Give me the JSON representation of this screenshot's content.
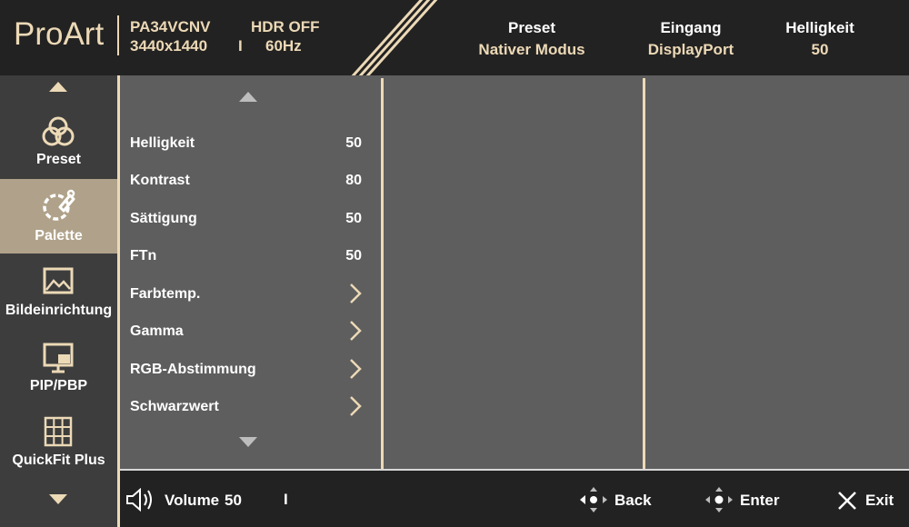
{
  "header": {
    "logo": "ProArt",
    "model": "PA34VCNV",
    "resolution": "3440x1440",
    "hdr": "HDR OFF",
    "separator": "I",
    "refresh": "60Hz",
    "preset_label": "Preset",
    "preset_value": "Nativer Modus",
    "input_label": "Eingang",
    "input_value": "DisplayPort",
    "brightness_label": "Helligkeit",
    "brightness_value": "50"
  },
  "sidebar": {
    "items": [
      {
        "label": "Preset",
        "icon": "color-circles-icon",
        "active": false
      },
      {
        "label": "Palette",
        "icon": "palette-icon",
        "active": true
      },
      {
        "label": "Bildeinrichtung",
        "icon": "image-icon",
        "active": false
      },
      {
        "label": "PIP/PBP",
        "icon": "pip-icon",
        "active": false
      },
      {
        "label": "QuickFit Plus",
        "icon": "grid-icon",
        "active": false
      }
    ]
  },
  "menu": {
    "items": [
      {
        "label": "Helligkeit",
        "value": "50"
      },
      {
        "label": "Kontrast",
        "value": "80"
      },
      {
        "label": "Sättigung",
        "value": "50"
      },
      {
        "label": "FTn",
        "value": "50"
      },
      {
        "label": "Farbtemp.",
        "value": null
      },
      {
        "label": "Gamma",
        "value": null
      },
      {
        "label": "RGB-Abstimmung",
        "value": null
      },
      {
        "label": "Schwarzwert",
        "value": null
      }
    ]
  },
  "footer": {
    "volume_label": "Volume",
    "volume_value": "50",
    "separator": "I",
    "back_label": "Back",
    "enter_label": "Enter",
    "exit_label": "Exit"
  },
  "colors": {
    "accent": "#ecd9b6",
    "active_item": "#b0a28a",
    "panel": "#5e5e5e",
    "sidebar": "#3d3d3d",
    "header": "#232222"
  }
}
